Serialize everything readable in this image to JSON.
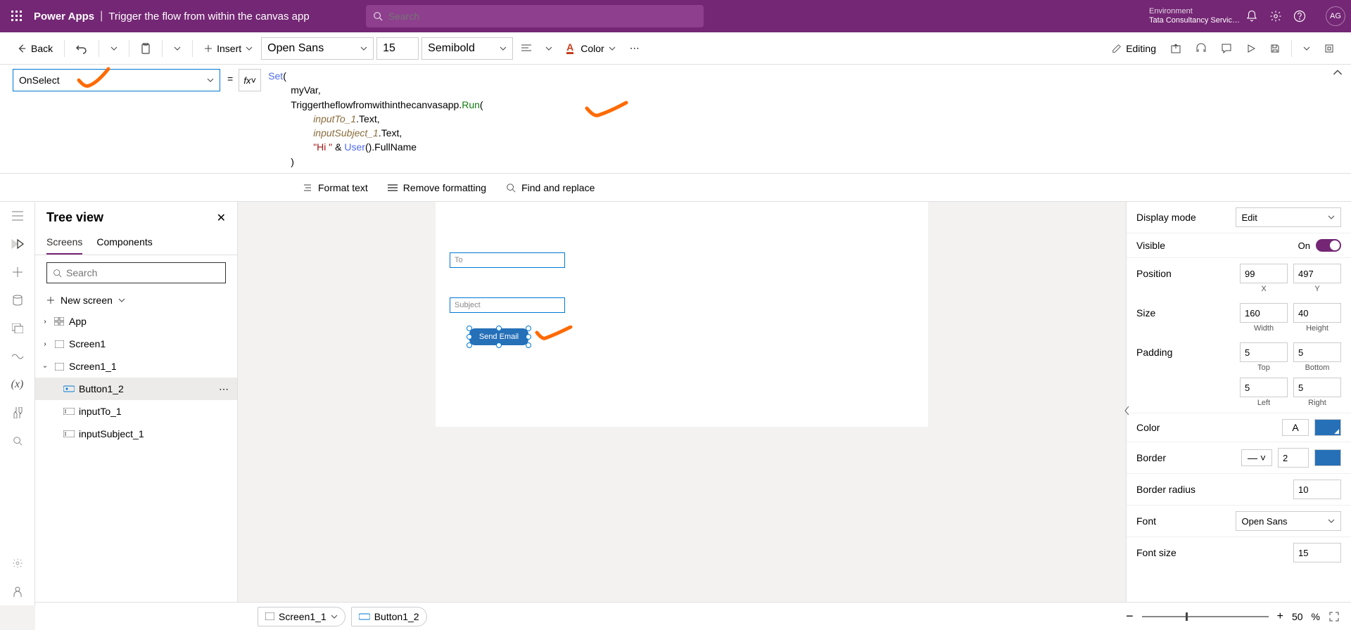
{
  "header": {
    "brand": "Power Apps",
    "title": "Trigger the flow from within the canvas app",
    "search_placeholder": "Search",
    "env_label": "Environment",
    "env_name": "Tata Consultancy Servic…",
    "avatar": "AG"
  },
  "toolbar": {
    "back": "Back",
    "insert": "Insert",
    "font": "Open Sans",
    "font_size": "15",
    "weight": "Semibold",
    "color": "Color",
    "editing": "Editing"
  },
  "formula": {
    "property": "OnSelect",
    "fx": "fx",
    "lines": {
      "l1a": "Set",
      "l1b": "(",
      "l2": "myVar,",
      "l3a": "Triggertheflowfromwithinthecanvasapp.",
      "l3b": "Run",
      "l3c": "(",
      "l4a": "inputTo_1",
      "l4b": ".Text,",
      "l5a": "inputSubject_1",
      "l5b": ".Text,",
      "l6a": "\"Hi \"",
      "l6b": " & ",
      "l6c": "User",
      "l6d": "().FullName",
      "l7": ")"
    },
    "tools": {
      "format": "Format text",
      "remove": "Remove formatting",
      "find": "Find and replace"
    }
  },
  "tree": {
    "title": "Tree view",
    "tab_screens": "Screens",
    "tab_components": "Components",
    "search_placeholder": "Search",
    "new_screen": "New screen",
    "items": [
      {
        "label": "App",
        "indent": 0,
        "expandable": true,
        "expanded": false,
        "icon": "app"
      },
      {
        "label": "Screen1",
        "indent": 0,
        "expandable": true,
        "expanded": false,
        "icon": "screen"
      },
      {
        "label": "Screen1_1",
        "indent": 0,
        "expandable": true,
        "expanded": true,
        "icon": "screen"
      },
      {
        "label": "Button1_2",
        "indent": 1,
        "selected": true,
        "icon": "button"
      },
      {
        "label": "inputTo_1",
        "indent": 1,
        "icon": "input"
      },
      {
        "label": "inputSubject_1",
        "indent": 1,
        "icon": "input"
      }
    ]
  },
  "canvas": {
    "to_placeholder": "To",
    "subject_placeholder": "Subject",
    "button_label": "Send Email"
  },
  "props": {
    "display_mode_label": "Display mode",
    "display_mode": "Edit",
    "visible_label": "Visible",
    "visible_on": "On",
    "position_label": "Position",
    "x": "99",
    "y": "497",
    "x_sub": "X",
    "y_sub": "Y",
    "size_label": "Size",
    "w": "160",
    "h": "40",
    "w_sub": "Width",
    "h_sub": "Height",
    "padding_label": "Padding",
    "top": "5",
    "bottom": "5",
    "left": "5",
    "right": "5",
    "top_sub": "Top",
    "bottom_sub": "Bottom",
    "left_sub": "Left",
    "right_sub": "Right",
    "color_label": "Color",
    "border_label": "Border",
    "border": "2",
    "radius_label": "Border radius",
    "radius": "10",
    "font_label": "Font",
    "font": "Open Sans",
    "font_size_label": "Font size",
    "font_size": "15"
  },
  "footer": {
    "crumb1": "Screen1_1",
    "crumb2": "Button1_2",
    "zoom": "50",
    "zoom_pct": "%"
  }
}
